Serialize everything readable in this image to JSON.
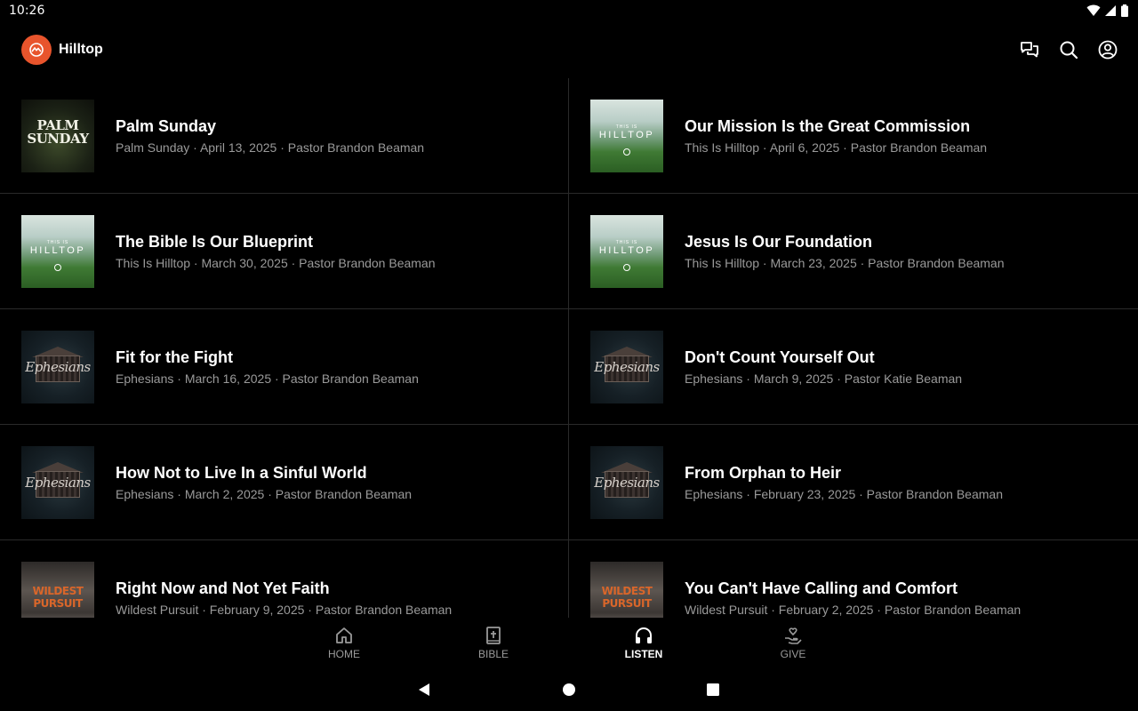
{
  "status": {
    "time": "10:26"
  },
  "app": {
    "title": "Hilltop"
  },
  "sermons": [
    {
      "title": "Palm Sunday",
      "meta": "Palm Sunday · April 13, 2025 · Pastor Brandon Beaman",
      "art": "palm",
      "art_text": "PALM SUNDAY"
    },
    {
      "title": "Our Mission Is the Great Commission",
      "meta": "This Is Hilltop · April 6, 2025 · Pastor Brandon Beaman",
      "art": "hilltop",
      "art_small": "THIS IS",
      "art_text": "HILLTOP"
    },
    {
      "title": "The Bible Is Our Blueprint",
      "meta": "This Is Hilltop · March 30, 2025 · Pastor Brandon Beaman",
      "art": "hilltop",
      "art_small": "THIS IS",
      "art_text": "HILLTOP"
    },
    {
      "title": "Jesus Is Our Foundation",
      "meta": "This Is Hilltop · March 23, 2025 · Pastor Brandon Beaman",
      "art": "hilltop",
      "art_small": "THIS IS",
      "art_text": "HILLTOP"
    },
    {
      "title": "Fit for the Fight",
      "meta": "Ephesians · March 16, 2025 · Pastor Brandon Beaman",
      "art": "eph",
      "art_text": "Ephesians"
    },
    {
      "title": "Don't Count Yourself Out",
      "meta": "Ephesians · March 9, 2025 · Pastor Katie Beaman",
      "art": "eph",
      "art_text": "Ephesians"
    },
    {
      "title": "How Not to Live In a Sinful World",
      "meta": "Ephesians · March 2, 2025 · Pastor Brandon Beaman",
      "art": "eph",
      "art_text": "Ephesians"
    },
    {
      "title": "From Orphan to Heir",
      "meta": "Ephesians · February 23, 2025 · Pastor Brandon Beaman",
      "art": "eph",
      "art_text": "Ephesians"
    },
    {
      "title": "Right Now and Not Yet Faith",
      "meta": "Wildest Pursuit · February 9, 2025 · Pastor Brandon Beaman",
      "art": "wild",
      "art_text": "WILDEST PURSUIT"
    },
    {
      "title": "You Can't Have Calling and Comfort",
      "meta": "Wildest Pursuit · February 2, 2025 · Pastor Brandon Beaman",
      "art": "wild",
      "art_text": "WILDEST PURSUIT"
    }
  ],
  "nav": {
    "items": [
      {
        "label": "HOME",
        "icon": "home-icon"
      },
      {
        "label": "BIBLE",
        "icon": "bible-icon"
      },
      {
        "label": "LISTEN",
        "icon": "headphones-icon",
        "active": true
      },
      {
        "label": "GIVE",
        "icon": "give-icon"
      }
    ]
  }
}
